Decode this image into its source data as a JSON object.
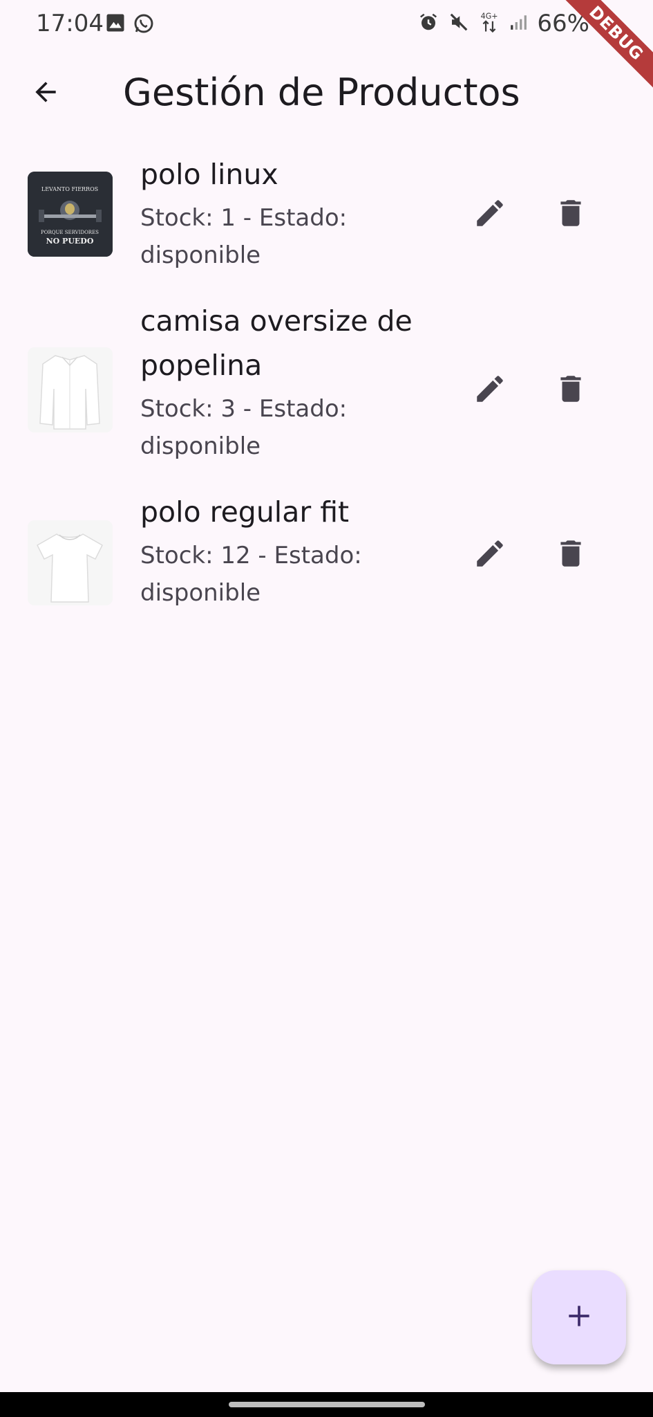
{
  "status_bar": {
    "time": "17:04",
    "battery": "66%",
    "left_icons": [
      "gallery-icon",
      "whatsapp-icon"
    ],
    "right_icons": [
      "alarm-icon",
      "mute-icon",
      "network-4g-icon",
      "signal-icon",
      "battery-icon"
    ]
  },
  "debug_banner": "DEBUG",
  "app_bar": {
    "title": "Gestión de Productos",
    "back_icon": "arrow-back-icon"
  },
  "products": [
    {
      "name": "polo linux",
      "stock_line": "Stock: 1 - Estado:",
      "state": "disponible",
      "image": "black-tshirt-print",
      "image_text": [
        "LEVANTO FIERROS",
        "PORQUE SERVIDORES",
        "NO PUEDO"
      ]
    },
    {
      "name": "camisa oversize de popelina",
      "name_line1": "camisa oversize de",
      "name_line2": "popelina",
      "stock_line": "Stock: 3 - Estado:",
      "state": "disponible",
      "image": "white-shirt"
    },
    {
      "name": "polo regular fit",
      "stock_line": "Stock: 12 - Estado:",
      "state": "disponible",
      "image": "white-tshirt"
    }
  ],
  "actions": {
    "edit_icon": "pencil-icon",
    "delete_icon": "trash-icon"
  },
  "fab": {
    "icon": "plus-icon"
  },
  "colors": {
    "background": "#fdf7fc",
    "fab": "#eaddff",
    "icon": "#49454f",
    "debug": "#b53b3b"
  }
}
